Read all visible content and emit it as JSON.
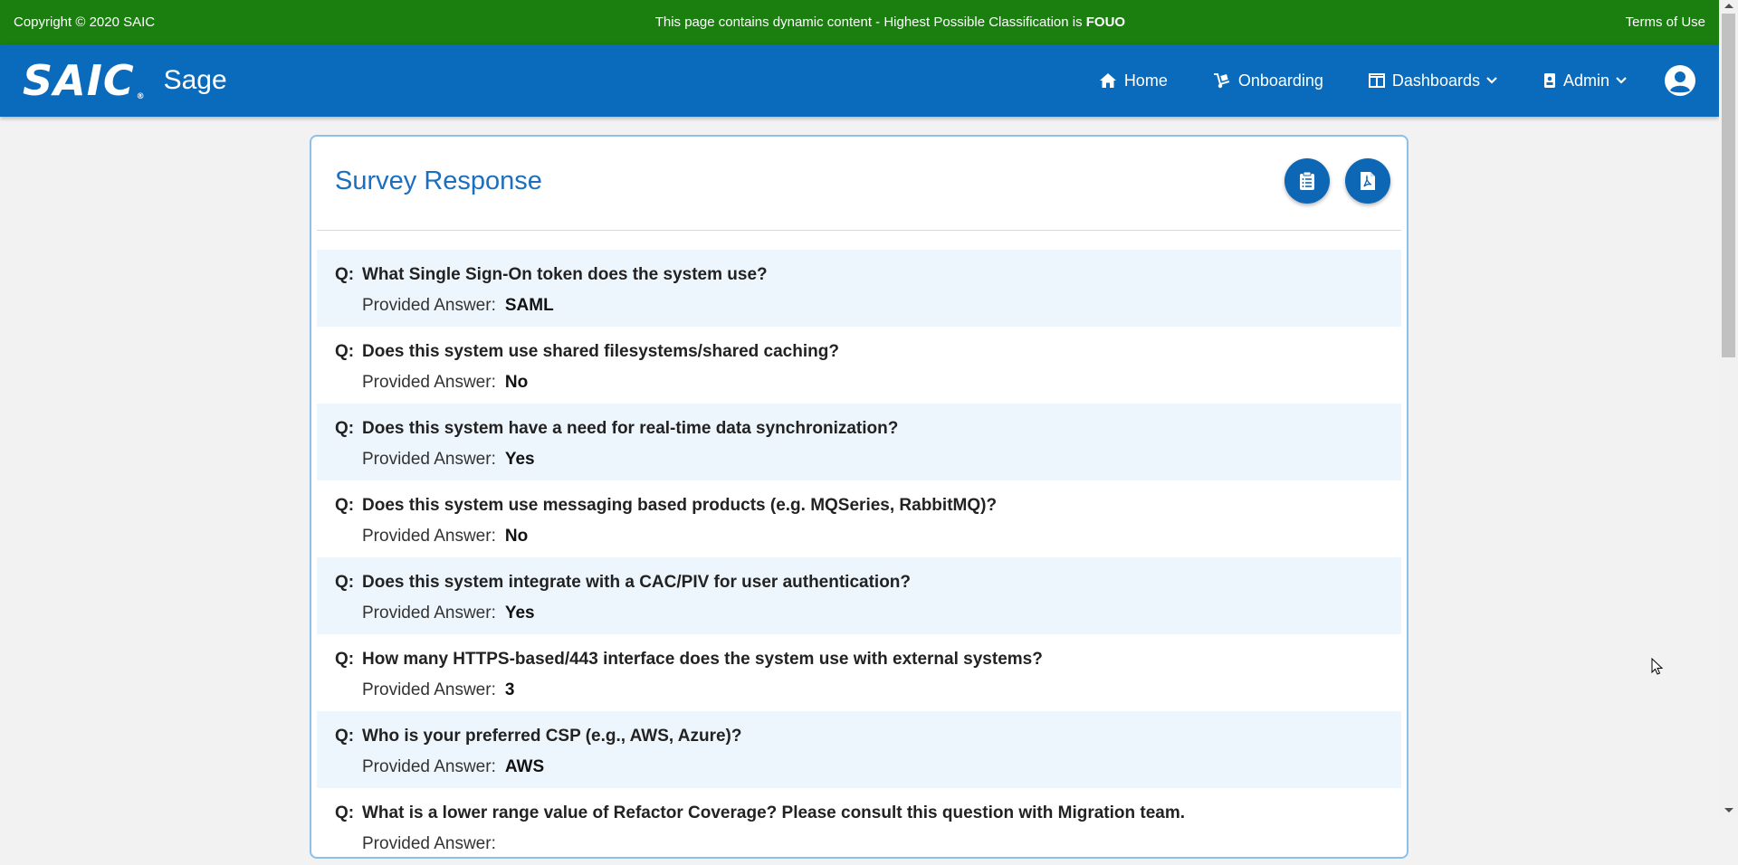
{
  "topbar": {
    "copyright": "Copyright © 2020 SAIC",
    "classification_prefix": "This page contains dynamic content - Highest Possible Classification is ",
    "classification_level": "FOUO",
    "terms": "Terms of Use",
    "background_color": "#1a7f0f"
  },
  "navbar": {
    "logo": "SAIC",
    "app_name": "Sage",
    "background_color": "#0a6bbd",
    "links": {
      "home": "Home",
      "onboarding": "Onboarding",
      "dashboards": "Dashboards",
      "admin": "Admin"
    },
    "icons": [
      "home-icon",
      "dolly-icon",
      "columns-icon",
      "id-badge-icon",
      "chevron-down-icon",
      "user-circle-icon"
    ]
  },
  "card": {
    "title": "Survey Response",
    "actions": [
      "clipboard-icon",
      "pdf-file-icon"
    ],
    "q_label": "Q:",
    "answer_label": "Provided Answer:",
    "items": [
      {
        "question": "What Single Sign-On token does the system use?",
        "answer": "SAML"
      },
      {
        "question": "Does this system use shared filesystems/shared caching?",
        "answer": "No"
      },
      {
        "question": "Does this system have a need for real-time data synchronization?",
        "answer": "Yes"
      },
      {
        "question": "Does this system use messaging based products (e.g. MQSeries, RabbitMQ)?",
        "answer": "No"
      },
      {
        "question": "Does this system integrate with a CAC/PIV for user authentication?",
        "answer": "Yes"
      },
      {
        "question": "How many HTTPS-based/443 interface does the system use with external systems?",
        "answer": "3"
      },
      {
        "question": "Who is your preferred CSP (e.g., AWS, Azure)?",
        "answer": "AWS"
      },
      {
        "question": "What is a lower range value of Refactor Coverage? Please consult this question with Migration team.",
        "answer": ""
      }
    ]
  }
}
